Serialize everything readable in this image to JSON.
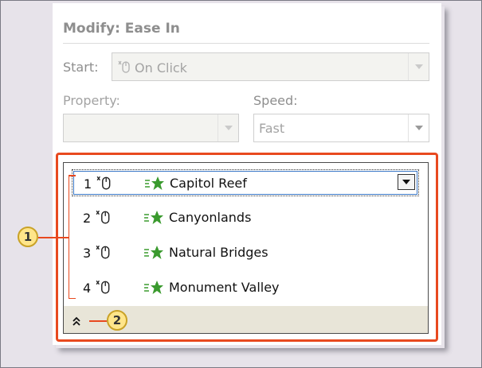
{
  "panel": {
    "title": "Modify: Ease In",
    "start_label": "Start:",
    "start_value": "On Click",
    "property_label": "Property:",
    "property_value": "",
    "speed_label": "Speed:",
    "speed_value": "Fast"
  },
  "animations": [
    {
      "order": "1",
      "name": "Capitol Reef",
      "selected": true
    },
    {
      "order": "2",
      "name": "Canyonlands",
      "selected": false
    },
    {
      "order": "3",
      "name": "Natural Bridges",
      "selected": false
    },
    {
      "order": "4",
      "name": "Monument Valley",
      "selected": false
    }
  ],
  "callouts": {
    "one": "1",
    "two": "2"
  },
  "colors": {
    "callout_red": "#e8491f",
    "callout_fill": "#ffe58a",
    "selection_blue": "#3c79c8",
    "star_green": "#3a9a2e"
  },
  "icons": [
    "mouse-click-icon",
    "ease-in-effect-icon",
    "collapse-chevron-icon",
    "dropdown-arrow-icon"
  ]
}
